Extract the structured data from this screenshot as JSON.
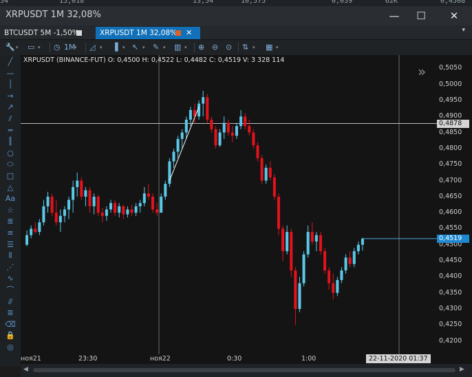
{
  "top_strip": [
    "34",
    "15,018",
    "13,54",
    "10,575",
    "0,039",
    "62K",
    "0,4508"
  ],
  "window": {
    "title": "XRPUSDT  1M   32,08%"
  },
  "window_controls": {
    "minimize": "—",
    "maximize": "☐",
    "close": "✕"
  },
  "tabs": [
    {
      "label": "BTCUSDT 5M -1,50%",
      "color": "#d9d9d9",
      "active": false
    },
    {
      "label": "XRPUSDT 1M  32,08%",
      "color": "#e06020",
      "active": true,
      "close": "✕"
    }
  ],
  "tab_menu": "▾",
  "toolbar": [
    {
      "icon": "wrench-icon",
      "glyph": "🔧"
    },
    {
      "icon": "folder-icon",
      "glyph": "▭"
    },
    {
      "icon": "clock-icon",
      "glyph": "◷"
    },
    {
      "icon": "interval-label",
      "glyph": "1M"
    },
    {
      "icon": "chart-type-icon",
      "glyph": "◿"
    },
    {
      "icon": "indicator-icon",
      "glyph": "▐"
    },
    {
      "icon": "cursor-icon",
      "glyph": "↖"
    },
    {
      "icon": "pencil-icon",
      "glyph": "✎"
    },
    {
      "icon": "bars-icon",
      "glyph": "▥"
    },
    {
      "icon": "zoom-in-icon",
      "glyph": "⊕"
    },
    {
      "icon": "zoom-out-icon",
      "glyph": "⊖"
    },
    {
      "icon": "zoom-fit-icon",
      "glyph": "⊙"
    },
    {
      "icon": "sort-icon",
      "glyph": "⇅"
    },
    {
      "icon": "grid-icon",
      "glyph": "▦"
    }
  ],
  "drawing_tools": [
    {
      "name": "line-tool-icon",
      "glyph": "╱"
    },
    {
      "name": "horizontal-line-icon",
      "glyph": "—"
    },
    {
      "name": "vertical-line-icon",
      "glyph": "│"
    },
    {
      "name": "arrow-right-icon",
      "glyph": "→"
    },
    {
      "name": "arrow-diagonal-icon",
      "glyph": "↗"
    },
    {
      "name": "parallel-lines-icon",
      "glyph": "⫽"
    },
    {
      "name": "horizontal-channel-icon",
      "glyph": "═"
    },
    {
      "name": "vertical-channel-icon",
      "glyph": "║"
    },
    {
      "name": "circle-icon",
      "glyph": "○"
    },
    {
      "name": "ellipse-icon",
      "glyph": "⬭"
    },
    {
      "name": "rectangle-icon",
      "glyph": "□"
    },
    {
      "name": "triangle-icon",
      "glyph": "△"
    },
    {
      "name": "text-icon",
      "glyph": "Aa"
    },
    {
      "name": "star-icon",
      "glyph": "☆"
    },
    {
      "name": "fibonacci-icon",
      "glyph": "≣"
    },
    {
      "name": "gann-icon",
      "glyph": "≡"
    },
    {
      "name": "levels-icon",
      "glyph": "☰"
    },
    {
      "name": "columns-icon",
      "glyph": "⦀"
    },
    {
      "name": "fan-icon",
      "glyph": "⋰"
    },
    {
      "name": "wave-icon",
      "glyph": "∿"
    },
    {
      "name": "arc-icon",
      "glyph": "⌒"
    },
    {
      "name": "pattern-icon",
      "glyph": "⫻"
    },
    {
      "name": "notes-icon",
      "glyph": "≣"
    },
    {
      "name": "eraser-icon",
      "glyph": "⌫"
    },
    {
      "name": "lock-icon",
      "glyph": "🔒"
    },
    {
      "name": "eye-icon",
      "glyph": "◎"
    }
  ],
  "info_line": "XRPUSDT (BINANCE-FUT)  O: 0,4500  H: 0,4522  L: 0,4482  C: 0,4519  V: 3 328 114",
  "price_axis": [
    "0,5050",
    "0,5000",
    "0,4950",
    "0,4900",
    "0,4850",
    "0,4800",
    "0,4750",
    "0,4700",
    "0,4650",
    "0,4600",
    "0,4550",
    "0,4500",
    "0,4450",
    "0,4400",
    "0,4350",
    "0,4300",
    "0,4250",
    "0,4200"
  ],
  "time_axis": [
    "ноя21",
    "23:30",
    "ноя22",
    "0:30",
    "1:00"
  ],
  "crosshair_price": "0,4878",
  "crosshair_time": "22-11-2020 01:37",
  "last_price": "0,4519",
  "colors": {
    "up": "#5bc8e8",
    "down": "#e3121c",
    "accent": "#1170b8",
    "last_price_bg": "#1e88d0"
  },
  "chart_data": {
    "type": "candlestick",
    "instrument": "XRPUSDT (BINANCE-FUT)",
    "ylim": [
      0.418,
      0.507
    ],
    "x_ticks": [
      "ноя21",
      "23:30",
      "ноя22",
      "0:30",
      "1:00"
    ],
    "note_values": "approximate OHLC read from 1-minute candles",
    "candles": [
      [
        0.45,
        0.4545,
        0.4495,
        0.453
      ],
      [
        0.453,
        0.456,
        0.452,
        0.455
      ],
      [
        0.455,
        0.457,
        0.4535,
        0.454
      ],
      [
        0.454,
        0.458,
        0.453,
        0.457
      ],
      [
        0.457,
        0.464,
        0.456,
        0.462
      ],
      [
        0.462,
        0.4665,
        0.46,
        0.465
      ],
      [
        0.465,
        0.466,
        0.459,
        0.46
      ],
      [
        0.46,
        0.464,
        0.456,
        0.457
      ],
      [
        0.457,
        0.461,
        0.454,
        0.459
      ],
      [
        0.459,
        0.462,
        0.457,
        0.461
      ],
      [
        0.461,
        0.465,
        0.458,
        0.464
      ],
      [
        0.464,
        0.47,
        0.46,
        0.468
      ],
      [
        0.468,
        0.4725,
        0.465,
        0.47
      ],
      [
        0.47,
        0.471,
        0.464,
        0.465
      ],
      [
        0.465,
        0.468,
        0.462,
        0.467
      ],
      [
        0.467,
        0.468,
        0.46,
        0.462
      ],
      [
        0.462,
        0.466,
        0.4595,
        0.465
      ],
      [
        0.465,
        0.4655,
        0.459,
        0.46
      ],
      [
        0.46,
        0.4615,
        0.457,
        0.459
      ],
      [
        0.459,
        0.462,
        0.4575,
        0.461
      ],
      [
        0.461,
        0.464,
        0.46,
        0.463
      ],
      [
        0.463,
        0.464,
        0.459,
        0.46
      ],
      [
        0.46,
        0.463,
        0.4585,
        0.462
      ],
      [
        0.462,
        0.4625,
        0.458,
        0.4595
      ],
      [
        0.4595,
        0.462,
        0.4585,
        0.461
      ],
      [
        0.461,
        0.4625,
        0.459,
        0.46
      ],
      [
        0.46,
        0.463,
        0.459,
        0.462
      ],
      [
        0.462,
        0.464,
        0.46,
        0.463
      ],
      [
        0.463,
        0.468,
        0.462,
        0.466
      ],
      [
        0.466,
        0.469,
        0.464,
        0.465
      ],
      [
        0.465,
        0.466,
        0.46,
        0.461
      ],
      [
        0.461,
        0.463,
        0.459,
        0.46
      ],
      [
        0.46,
        0.466,
        0.46,
        0.465
      ],
      [
        0.465,
        0.47,
        0.464,
        0.469
      ],
      [
        0.469,
        0.477,
        0.468,
        0.476
      ],
      [
        0.476,
        0.48,
        0.474,
        0.479
      ],
      [
        0.479,
        0.484,
        0.477,
        0.483
      ],
      [
        0.483,
        0.486,
        0.48,
        0.485
      ],
      [
        0.485,
        0.49,
        0.483,
        0.489
      ],
      [
        0.489,
        0.493,
        0.487,
        0.492
      ],
      [
        0.492,
        0.494,
        0.488,
        0.49
      ],
      [
        0.49,
        0.495,
        0.489,
        0.494
      ],
      [
        0.494,
        0.498,
        0.49,
        0.496
      ],
      [
        0.496,
        0.497,
        0.488,
        0.489
      ],
      [
        0.489,
        0.49,
        0.485,
        0.486
      ],
      [
        0.486,
        0.487,
        0.48,
        0.481
      ],
      [
        0.481,
        0.486,
        0.4805,
        0.485
      ],
      [
        0.485,
        0.49,
        0.483,
        0.488
      ],
      [
        0.488,
        0.489,
        0.484,
        0.485
      ],
      [
        0.485,
        0.487,
        0.482,
        0.484
      ],
      [
        0.484,
        0.488,
        0.483,
        0.487
      ],
      [
        0.487,
        0.492,
        0.486,
        0.49
      ],
      [
        0.49,
        0.491,
        0.486,
        0.487
      ],
      [
        0.487,
        0.489,
        0.484,
        0.485
      ],
      [
        0.485,
        0.486,
        0.48,
        0.481
      ],
      [
        0.481,
        0.482,
        0.476,
        0.477
      ],
      [
        0.477,
        0.478,
        0.469,
        0.47
      ],
      [
        0.47,
        0.475,
        0.469,
        0.474
      ],
      [
        0.474,
        0.476,
        0.47,
        0.471
      ],
      [
        0.471,
        0.472,
        0.464,
        0.465
      ],
      [
        0.465,
        0.466,
        0.453,
        0.455
      ],
      [
        0.455,
        0.456,
        0.445,
        0.448
      ],
      [
        0.448,
        0.456,
        0.447,
        0.454
      ],
      [
        0.454,
        0.455,
        0.44,
        0.442
      ],
      [
        0.442,
        0.443,
        0.425,
        0.43
      ],
      [
        0.43,
        0.44,
        0.429,
        0.438
      ],
      [
        0.438,
        0.448,
        0.437,
        0.447
      ],
      [
        0.447,
        0.456,
        0.446,
        0.454
      ],
      [
        0.454,
        0.457,
        0.45,
        0.451
      ],
      [
        0.451,
        0.454,
        0.448,
        0.453
      ],
      [
        0.453,
        0.454,
        0.447,
        0.448
      ],
      [
        0.448,
        0.449,
        0.441,
        0.442
      ],
      [
        0.442,
        0.443,
        0.436,
        0.438
      ],
      [
        0.438,
        0.441,
        0.433,
        0.435
      ],
      [
        0.435,
        0.44,
        0.434,
        0.439
      ],
      [
        0.439,
        0.443,
        0.438,
        0.442
      ],
      [
        0.442,
        0.447,
        0.441,
        0.446
      ],
      [
        0.446,
        0.448,
        0.443,
        0.444
      ],
      [
        0.444,
        0.449,
        0.443,
        0.448
      ],
      [
        0.448,
        0.451,
        0.447,
        0.45
      ],
      [
        0.45,
        0.4522,
        0.4482,
        0.4519
      ]
    ],
    "trend_line": {
      "from": [
        34,
        0.47
      ],
      "to": [
        41,
        0.493
      ]
    },
    "crosshair": {
      "price": 0.4878,
      "index": 73
    }
  }
}
